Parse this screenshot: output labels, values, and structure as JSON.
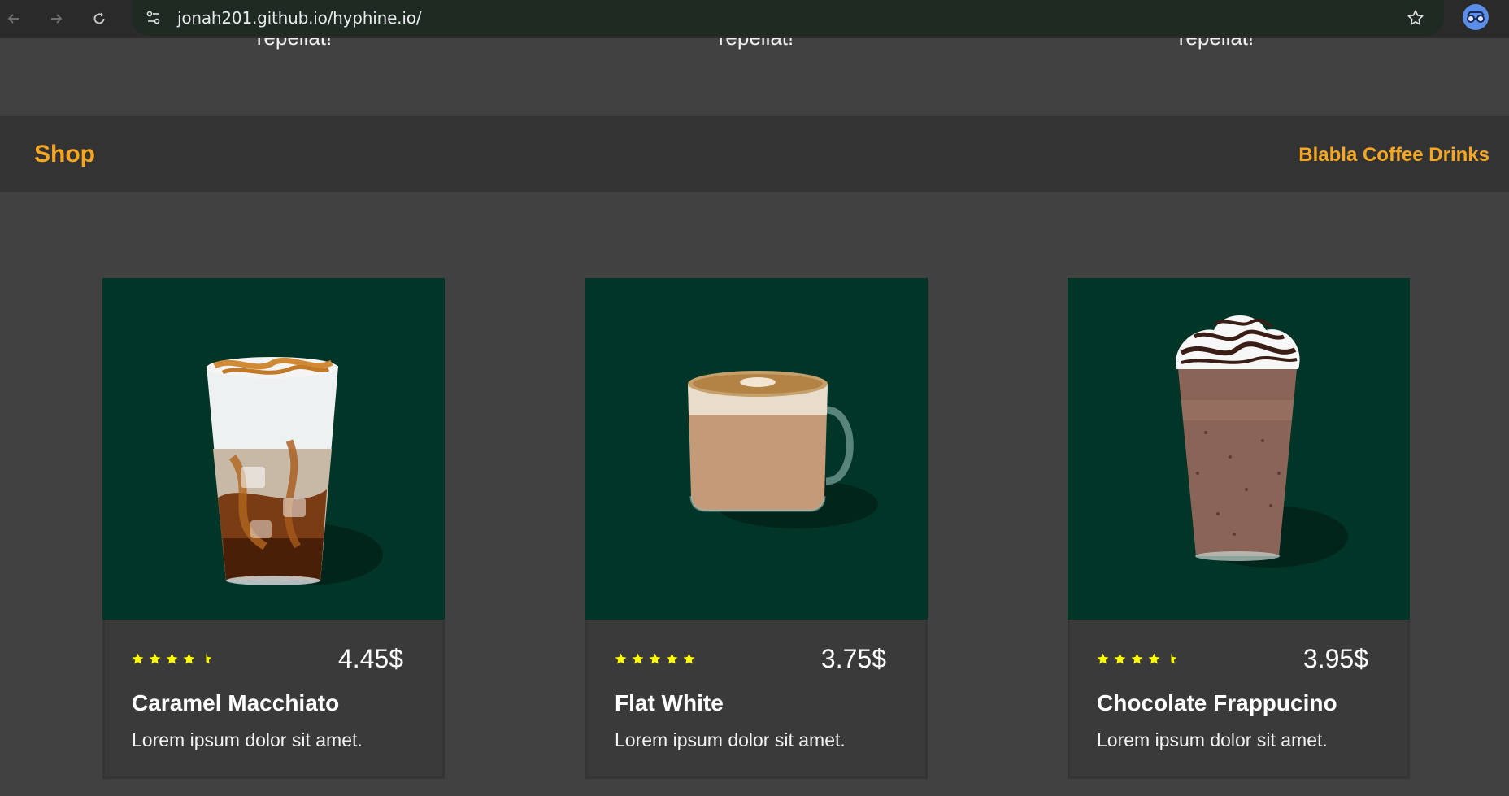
{
  "browser": {
    "url": "jonah201.github.io/hyphine.io/"
  },
  "top_section": {
    "cut_texts": [
      "repellat!",
      "repellat!",
      "repellat!"
    ]
  },
  "shop": {
    "title": "Shop",
    "subtitle": "Blabla Coffee Drinks"
  },
  "products": [
    {
      "name": "Caramel Macchiato",
      "price": "4.45$",
      "description": "Lorem ipsum dolor sit amet.",
      "rating": 4.5,
      "image": "iced-caramel-macchiato-glass"
    },
    {
      "name": "Flat White",
      "price": "3.75$",
      "description": "Lorem ipsum dolor sit amet.",
      "rating": 5,
      "image": "flat-white-glass-mug"
    },
    {
      "name": "Chocolate Frappucino",
      "price": "3.95$",
      "description": "Lorem ipsum dolor sit amet.",
      "rating": 4.5,
      "image": "chocolate-frappuccino-glass"
    }
  ],
  "colors": {
    "accent": "#f5a623",
    "star": "#ffff00",
    "product_bg": "#013527",
    "page_bg": "#414141"
  }
}
